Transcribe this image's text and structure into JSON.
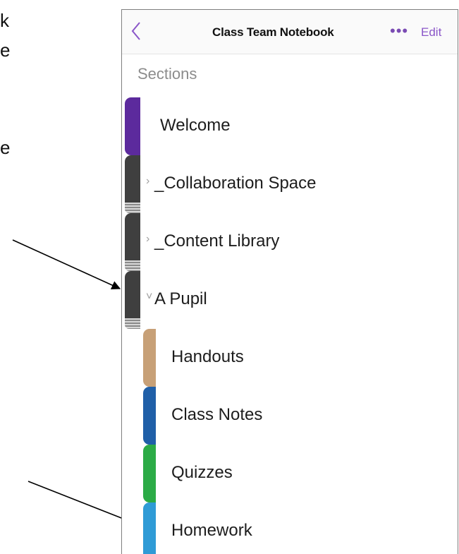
{
  "document": {
    "left_text_fragments": [
      "k",
      "e",
      "e"
    ]
  },
  "header": {
    "title": "Class Team Notebook",
    "more_glyph": "•••",
    "edit_label": "Edit",
    "back_icon": "chevron-left-icon"
  },
  "sections": {
    "header": "Sections",
    "items": [
      {
        "label": "Welcome",
        "color": "#5c2a9d",
        "chevron": ""
      },
      {
        "label": "_Collaboration Space",
        "color": "#3f3f3f",
        "chevron": "›"
      },
      {
        "label": "_Content Library",
        "color": "#3f3f3f",
        "chevron": "›"
      },
      {
        "label": "A Pupil",
        "color": "#3f3f3f",
        "chevron": "˅"
      },
      {
        "label": "Handouts",
        "color": "#c7a077",
        "chevron": ""
      },
      {
        "label": "Class Notes",
        "color": "#1f5fa8",
        "chevron": ""
      },
      {
        "label": "Quizzes",
        "color": "#2bab46",
        "chevron": ""
      },
      {
        "label": "Homework",
        "color": "#2f9bd6",
        "chevron": ""
      }
    ]
  },
  "colors": {
    "accent": "#8a56c8"
  }
}
